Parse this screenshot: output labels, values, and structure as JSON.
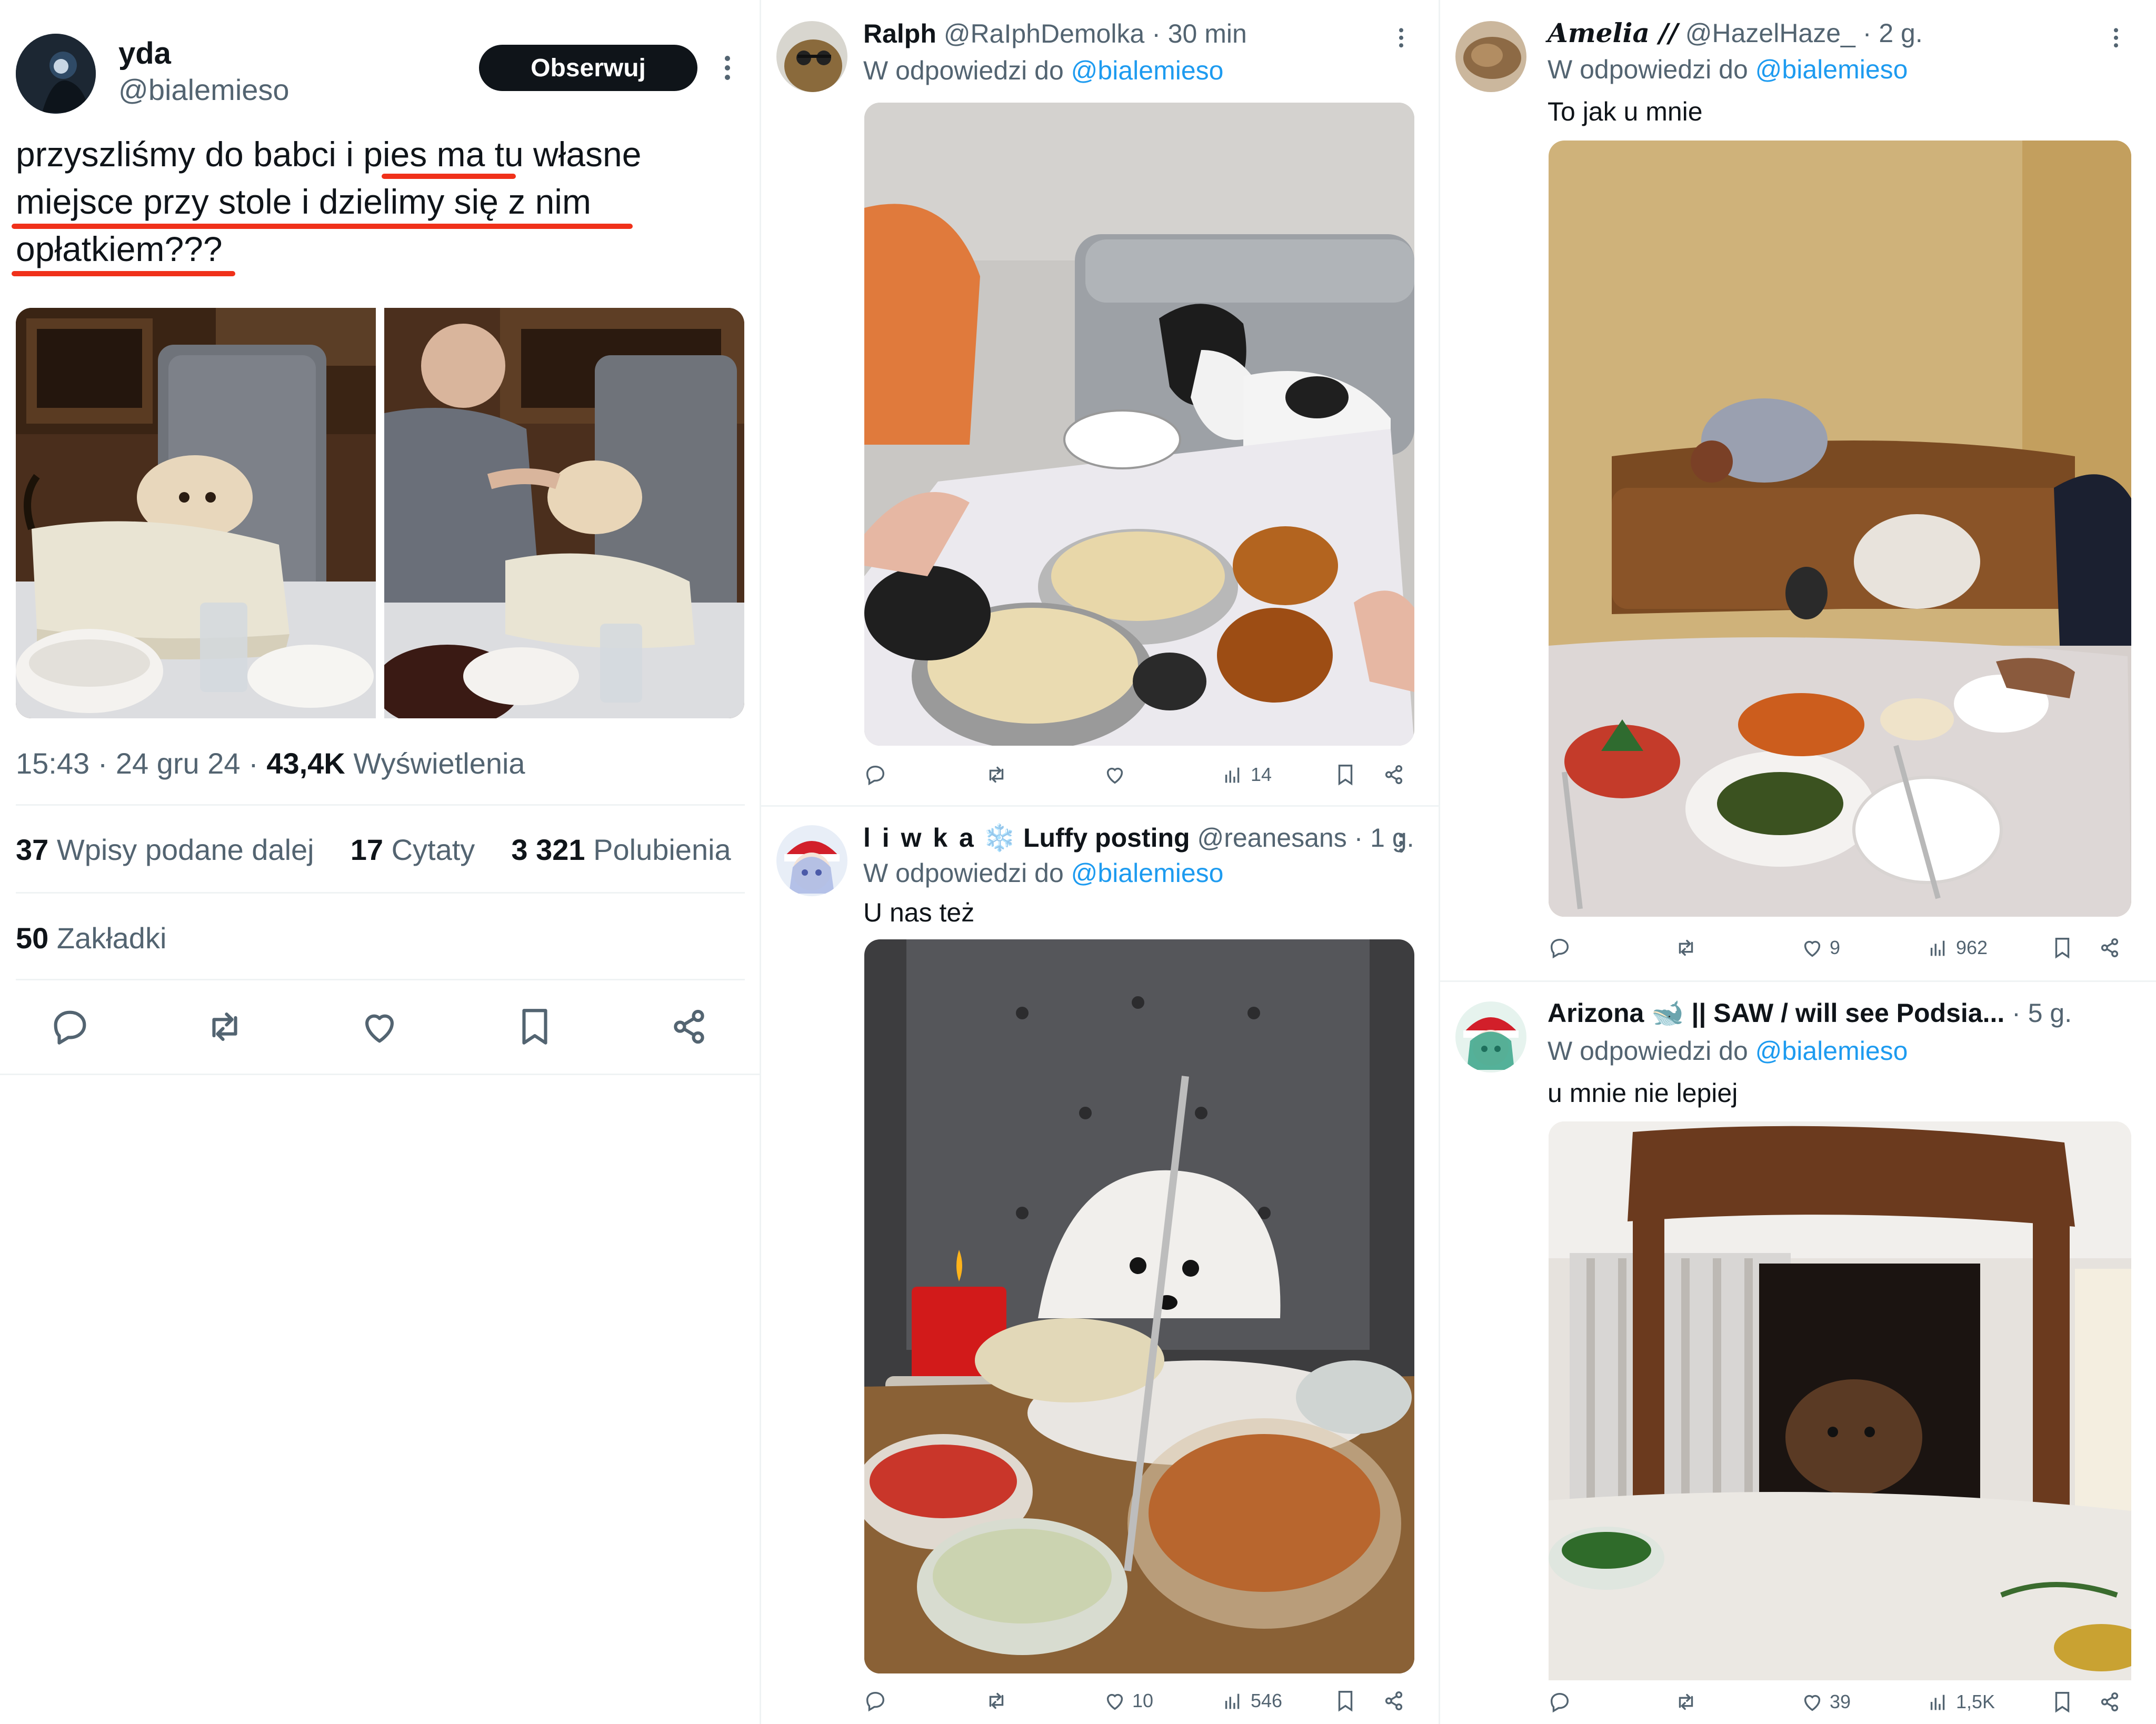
{
  "colors": {
    "accent": "#1d9bf0",
    "text": "#0f1419",
    "muted": "#536471",
    "underline": "#f0311a"
  },
  "main": {
    "name": "yda",
    "handle": "@bialemieso",
    "follow_label": "Obserwuj",
    "text_lines": [
      "przyszliśmy do babci i pies ma tu własne",
      "miejsce przy stole i dzielimy się z nim",
      "opłatkiem???"
    ],
    "images": [
      "dog-at-table-photo",
      "grandpa-feeding-dog-photo"
    ],
    "time": "15:43",
    "date": "24 gru 24",
    "views_count": "43,4K",
    "views_label": "Wyświetlenia",
    "reposts_count": "37",
    "reposts_label": "Wpisy podane dalej",
    "quotes_count": "17",
    "quotes_label": "Cytaty",
    "likes_count": "3 321",
    "likes_label": "Polubienia",
    "bookmarks_count": "50",
    "bookmarks_label": "Zakładki",
    "icons": [
      "reply-icon",
      "repost-icon",
      "like-icon",
      "bookmark-icon",
      "share-icon"
    ]
  },
  "replies": [
    {
      "name": "Ralph",
      "handle": "@RaIphDemolka",
      "time": "30 min",
      "reply_prefix": "W odpowiedzi do",
      "reply_to": "@bialemieso",
      "text": "",
      "likes": "",
      "views": "14"
    },
    {
      "name": "l i w k a",
      "name_extra": "Luffy posting",
      "emoji": "❄️",
      "handle": "@reanesans",
      "time": "1 g.",
      "reply_prefix": "W odpowiedzi do",
      "reply_to": "@bialemieso",
      "text": "U nas też",
      "likes": "10",
      "views": "546"
    },
    {
      "name": "Amelia //",
      "handle": "@HazelHaze_",
      "time": "2 g.",
      "reply_prefix": "W odpowiedzi do",
      "reply_to": "@bialemieso",
      "text": "To jak u mnie",
      "likes": "9",
      "views": "962"
    },
    {
      "name": "Arizona",
      "emoji": "🐋",
      "name_extra": "|| SAW / will see Podsia...",
      "handle": "",
      "time": "5 g.",
      "reply_prefix": "W odpowiedzi do",
      "reply_to": "@bialemieso",
      "text": "u mnie nie lepiej",
      "likes": "39",
      "views": "1,5K"
    }
  ]
}
